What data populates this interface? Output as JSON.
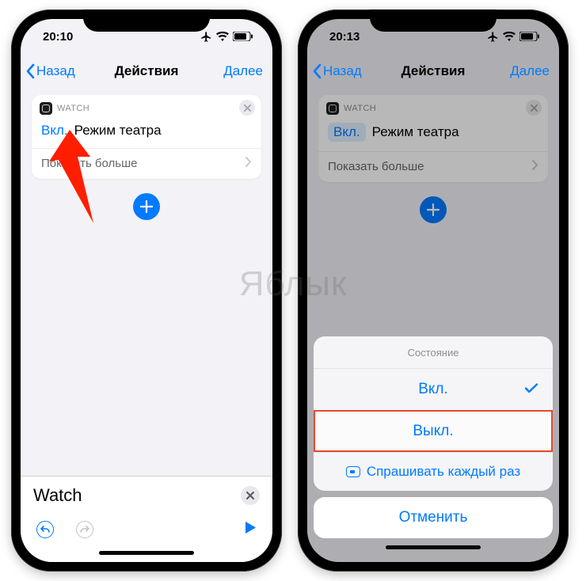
{
  "watermark": "Яблык",
  "left": {
    "time": "20:10",
    "nav": {
      "back": "Назад",
      "title": "Действия",
      "next": "Далее"
    },
    "card": {
      "app": "WATCH",
      "toggle": "Вкл.",
      "toggle_style": "plain",
      "action": "Режим театра",
      "more": "Показать больше"
    },
    "search": {
      "value": "Watch"
    }
  },
  "right": {
    "time": "20:13",
    "nav": {
      "back": "Назад",
      "title": "Действия",
      "next": "Далее"
    },
    "card": {
      "app": "WATCH",
      "toggle": "Вкл.",
      "toggle_style": "pill",
      "action": "Режим театра",
      "more": "Показать больше"
    },
    "sheet": {
      "title": "Состояние",
      "on": "Вкл.",
      "off": "Выкл.",
      "ask": "Спрашивать каждый раз",
      "cancel": "Отменить"
    }
  }
}
